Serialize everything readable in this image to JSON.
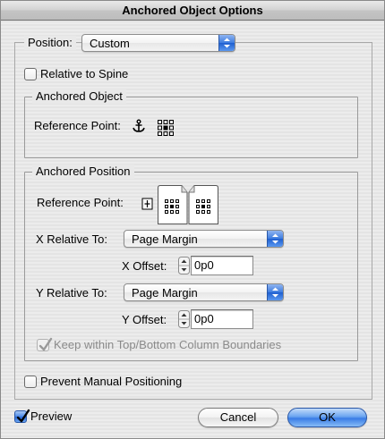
{
  "window": {
    "title": "Anchored Object Options"
  },
  "position": {
    "label": "Position:",
    "value": "Custom"
  },
  "relative_to_spine": {
    "label": "Relative to Spine",
    "checked": false
  },
  "anchored_object": {
    "title": "Anchored Object",
    "reference_point_label": "Reference Point:",
    "icon": "anchor-icon"
  },
  "anchored_position": {
    "title": "Anchored Position",
    "reference_point_label": "Reference Point:",
    "x_relative_label": "X Relative To:",
    "x_relative_value": "Page Margin",
    "x_offset_label": "X Offset:",
    "x_offset_value": "0p0",
    "y_relative_label": "Y Relative To:",
    "y_relative_value": "Page Margin",
    "y_offset_label": "Y Offset:",
    "y_offset_value": "0p0",
    "keep_within_label": "Keep within Top/Bottom Column Boundaries",
    "keep_within_checked": true,
    "keep_within_enabled": false
  },
  "prevent_manual": {
    "label": "Prevent Manual Positioning",
    "checked": false
  },
  "footer": {
    "preview_label": "Preview",
    "preview_checked": true,
    "cancel_label": "Cancel",
    "ok_label": "OK"
  },
  "colors": {
    "accent": "#3a7ce6",
    "disabled_text": "#8a8a8a"
  }
}
